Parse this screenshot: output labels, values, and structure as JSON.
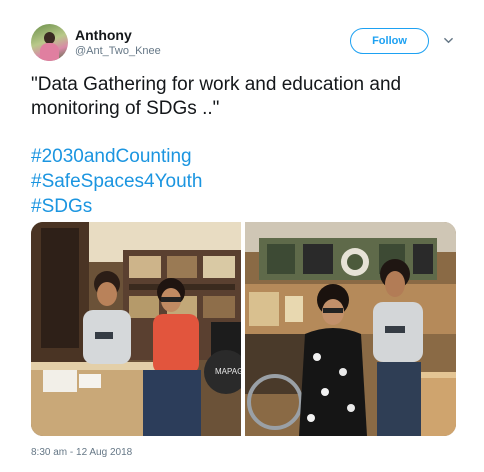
{
  "tweet": {
    "author": {
      "display_name": "Anthony",
      "handle": "@Ant_Two_Knee",
      "avatar_icon": "profile-photo"
    },
    "follow_label": "Follow",
    "menu_icon": "chevron-down-icon",
    "text": "\"Data Gathering for work and education and monitoring of SDGs ..\"",
    "hashtags": [
      "#2030andCounting",
      "#SafeSpaces4Youth",
      "#SDGs"
    ],
    "timestamp": "8:30 am - 12 Aug 2018",
    "colors": {
      "accent": "#1da1f2",
      "hashtag": "#1b95e0",
      "secondary_text": "#657786"
    }
  }
}
